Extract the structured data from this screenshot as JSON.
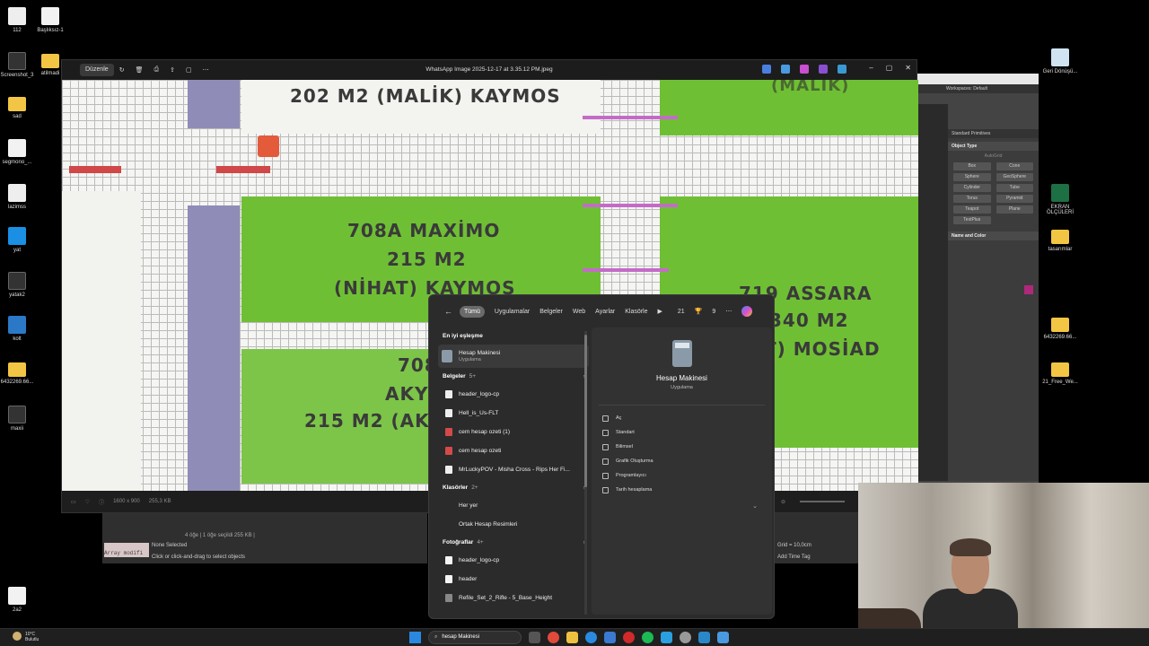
{
  "desktop_icons_left": [
    {
      "label": "112",
      "kind": "cube"
    },
    {
      "label": "Başlıksız-1",
      "kind": "file"
    },
    {
      "label": "Screenshot_3",
      "kind": "dark"
    },
    {
      "label": "atilmadi",
      "kind": "folder"
    },
    {
      "label": "sad",
      "kind": "folder"
    },
    {
      "label": "segmono_...",
      "kind": "file"
    },
    {
      "label": "lazimss",
      "kind": "cube"
    },
    {
      "label": "yat",
      "kind": "blue"
    },
    {
      "label": "yatak2",
      "kind": "dark"
    },
    {
      "label": "kolt",
      "kind": "max"
    },
    {
      "label": "6432269.66...",
      "kind": "folder"
    },
    {
      "label": "maxii",
      "kind": "dark"
    },
    {
      "label": "2a2",
      "kind": "file"
    }
  ],
  "desktop_icons_right": [
    {
      "label": "Geri Dönüşü...",
      "kind": "recycle"
    },
    {
      "label": "EKRAN ÖLÇÜLERİ",
      "kind": "excel"
    },
    {
      "label": "tasarımlar",
      "kind": "folder"
    },
    {
      "label": "6432269.66...",
      "kind": "folder"
    },
    {
      "label": "21_Free_We...",
      "kind": "folder"
    }
  ],
  "viewer": {
    "title": "WhatsApp Image 2025-12-17 at 3.35.12 PM.jpeg",
    "edit_label": "Düzenle",
    "toolbar_icons": [
      "rotate-icon",
      "delete-icon",
      "print-icon",
      "share-icon",
      "fit-icon",
      "more-icon"
    ],
    "status_dimensions": "1600 x 900",
    "status_size": "255,3 KB",
    "photo_text": {
      "top_label": "202  M2 (MALİK) KAYMOS",
      "top_right": "(MALİK)",
      "center_code": "708A  MAXİMO",
      "center_area": "215 M2",
      "center_owner": "(NİHAT) KAYMOS",
      "right_code": "719  ASSARA",
      "right_area": "340 M2",
      "right_owner": "T) MOSİAD",
      "left_code": "708",
      "left_name": "AKY",
      "left_area": "215 M2 (AKI"
    }
  },
  "max_panel": {
    "workspace": "Workspaces: Default",
    "dropdown": "Standard Primitives",
    "section_object_type": "Object Type",
    "autogrid": "AutoGrid",
    "buttons": [
      "Box",
      "Cone",
      "Sphere",
      "GeoSphere",
      "Cylinder",
      "Tube",
      "Torus",
      "Pyramid",
      "Teapot",
      "Plane",
      "TextPlus"
    ],
    "section_name_color": "Name and Color"
  },
  "max_bottom": {
    "selection": "4 öğe  |  1 öğe seçildi  255 KB  |",
    "none_selected": "None Selected",
    "hint": "Click or click-and-drag to select objects",
    "script": "Array modifi",
    "grid": "Grid = 10,0cm",
    "add_time_tag": "Add Time Tag"
  },
  "search_panel": {
    "tabs": [
      "Tümü",
      "Uygulamalar",
      "Belgeler",
      "Web",
      "Ayarlar",
      "Klasörle"
    ],
    "count1": "21",
    "count2": "9",
    "best_match_header": "En iyi eşleşme",
    "best_match": {
      "name": "Hesap Makinesi",
      "type": "Uygulama"
    },
    "documents_header": "Belgeler",
    "documents_count": "5+",
    "documents": [
      {
        "name": "header_logo-cp",
        "icon": "doc"
      },
      {
        "name": "Hell_is_Us-FLT",
        "icon": "doc"
      },
      {
        "name": "cem hesap ozeti (1)",
        "icon": "pdf"
      },
      {
        "name": "cem hesap ozeti",
        "icon": "pdf"
      },
      {
        "name": "MrLuckyPOV - Misha Cross - Rips Her Fi...",
        "icon": "doc"
      }
    ],
    "folders_header": "Klasörler",
    "folders_count": "2+",
    "folders": [
      {
        "name": "Her yer",
        "icon": "none"
      },
      {
        "name": "Ortak Hesap Resimleri",
        "icon": "none"
      }
    ],
    "photos_header": "Fotoğraflar",
    "photos_count": "4+",
    "photos": [
      {
        "name": "header_logo-cp",
        "icon": "img"
      },
      {
        "name": "header",
        "icon": "img"
      },
      {
        "name": "Refile_Set_2_Rifle - 5_Base_Height",
        "icon": "gray"
      }
    ],
    "detail": {
      "name": "Hesap Makinesi",
      "type": "Uygulama",
      "actions": [
        "Aç",
        "Standart",
        "Bilimsel",
        "Grafik Oluşturma",
        "Programlayıcı",
        "Tarih hesaplama"
      ]
    }
  },
  "taskbar": {
    "weather_temp": "10°C",
    "weather_desc": "Bulutlu",
    "search_value": "hesap Makinesi"
  }
}
